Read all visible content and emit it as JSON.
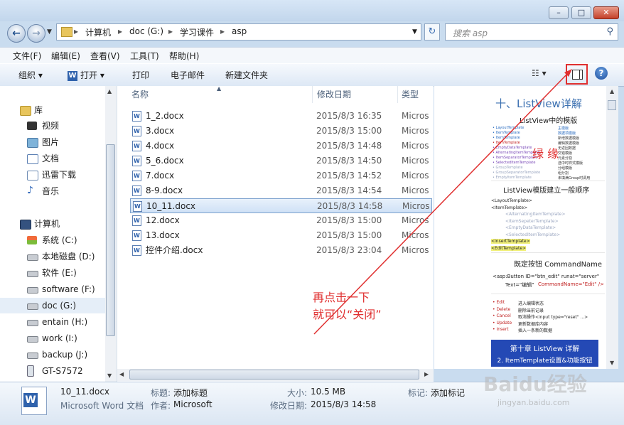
{
  "titlebar": {
    "min": "–",
    "max": "□",
    "close": "✕"
  },
  "address": {
    "crumbs": [
      "计算机",
      "doc (G:)",
      "学习课件",
      "asp"
    ],
    "sep": "▸",
    "search_placeholder": "搜索 asp"
  },
  "menu": [
    "文件(F)",
    "编辑(E)",
    "查看(V)",
    "工具(T)",
    "帮助(H)"
  ],
  "toolbar": {
    "organize": "组织 ▾",
    "open": "打开 ▾",
    "print": "打印",
    "email": "电子邮件",
    "new_folder": "新建文件夹"
  },
  "nav": {
    "libraries": "库",
    "lib_items": [
      "视频",
      "图片",
      "文档",
      "迅雷下载",
      "音乐"
    ],
    "computer": "计算机",
    "drives": [
      "系统 (C:)",
      "本地磁盘 (D:)",
      "软件 (E:)",
      "software (F:)",
      "doc (G:)",
      "entain (H:)",
      "work (I:)",
      "backup (J:)",
      "GT-S7572"
    ]
  },
  "columns": {
    "name": "名称",
    "date": "修改日期",
    "type": "类型"
  },
  "files": [
    {
      "name": "1_2.docx",
      "date": "2015/8/3 16:35",
      "type": "Micros"
    },
    {
      "name": "3.docx",
      "date": "2015/8/3 15:00",
      "type": "Micros"
    },
    {
      "name": "4.docx",
      "date": "2015/8/3 14:48",
      "type": "Micros"
    },
    {
      "name": "5_6.docx",
      "date": "2015/8/3 14:50",
      "type": "Micros"
    },
    {
      "name": "7.docx",
      "date": "2015/8/3 14:52",
      "type": "Micros"
    },
    {
      "name": "8-9.docx",
      "date": "2015/8/3 14:54",
      "type": "Micros"
    },
    {
      "name": "10_11.docx",
      "date": "2015/8/3 14:58",
      "type": "Micros"
    },
    {
      "name": "12.docx",
      "date": "2015/8/3 15:00",
      "type": "Micros"
    },
    {
      "name": "13.docx",
      "date": "2015/8/3 15:00",
      "type": "Micros"
    },
    {
      "name": "控件介绍.docx",
      "date": "2015/8/3 23:04",
      "type": "Micros"
    }
  ],
  "annotation": {
    "line1": "再点击一下",
    "line2": "就可以“关闭”"
  },
  "preview": {
    "title": "十、ListView详解",
    "sub1": "ListView中的模版",
    "templates": [
      "LayoutTemplate",
      "ItemTemplate",
      "ItemTemplate",
      "ItemTemplate",
      "EmptyDataTemplate",
      "AlternatingItemTemplate",
      "ItemSeparatorTemplate",
      "SelectedItemTemplate",
      "GroupTemplate",
      "GroupSeparatorTemplate",
      "EmptyItemTemplate"
    ],
    "descs": [
      "主模版",
      "数据项模版",
      "新增数据模版",
      "编辑数据模版",
      "无返回数据",
      "交错模版",
      "元素分割",
      "选中时样式模版",
      "分组模版",
      "组分割",
      "未填满Group时调用"
    ],
    "side_note": "绿 缘",
    "sub2": "ListView模版建立一般顺序",
    "order": [
      "<LayoutTemplate>",
      "<ItemTemplate>",
      "<AlternatingItemTemplate>",
      "<ItemSepeterTemplate>",
      "<EmptyDataTemplate>",
      "<SelectedItemTemplate>",
      "<InsertTemplate>",
      "<EditTemplate>"
    ],
    "sub3": "既定按钮 CommandName",
    "code1": "<asp:Button  ID=\"btn_edit\"   runat=\"server\"",
    "code2": "Text=\"编辑\"",
    "code3": "CommandName=\"Edit\" />",
    "cmds": [
      {
        "k": "Edit",
        "v": "进入编辑状态"
      },
      {
        "k": "Delete",
        "v": "删除当前记录"
      },
      {
        "k": "Cancel",
        "v": "取消操作<input type=\"reset\" ...>"
      },
      {
        "k": "Update",
        "v": "更新数据库内容"
      },
      {
        "k": "Insert",
        "v": "插入一条新的数据"
      }
    ],
    "banner1": "第十章 ListView 详解",
    "banner2": "2. ItemTemplate设置&功能按钮"
  },
  "details": {
    "filename": "10_11.docx",
    "filetype": "Microsoft Word 文档",
    "title_label": "标题:",
    "title_value": "添加标题",
    "author_label": "作者:",
    "author_value": "Microsoft",
    "size_label": "大小:",
    "size_value": "10.5 MB",
    "modified_label": "修改日期:",
    "modified_value": "2015/8/3 14:58",
    "tags_label": "标记:",
    "tags_value": "添加标记"
  },
  "watermark": {
    "main": "Baidu经验",
    "sub": "jingyan.baidu.com"
  },
  "colors": {
    "annotation": "#e03030",
    "selection": "#cfe1f6",
    "banner": "#2449b5"
  }
}
